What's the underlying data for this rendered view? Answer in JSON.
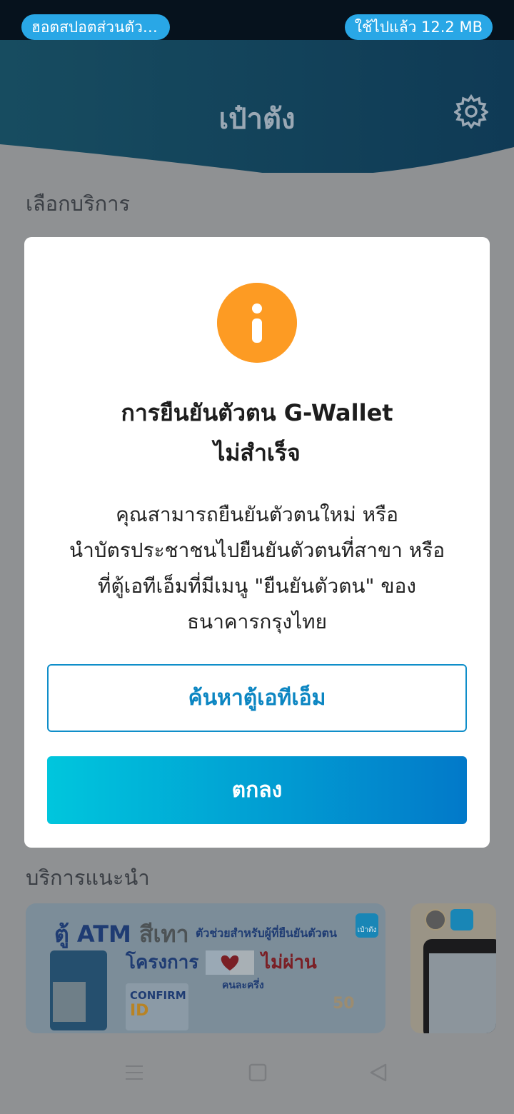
{
  "status_bar": {
    "hotspot_label": "ฮอตสปอตส่วนตัว ...",
    "data_usage_label": "ใช้ไปแล้ว 12.2 MB"
  },
  "header": {
    "title": "เป๋าตัง",
    "settings_icon": "gear-icon"
  },
  "main": {
    "select_service_label": "เลือกบริการ",
    "recommended_label": "บริการแนะนำ",
    "banners": [
      {
        "title_prefix": "ตู้ ATM",
        "title_color_word": "สีเทา",
        "subtitle": "ตัวช่วยสำหรับผู้ที่ยืนยันตัวตน",
        "project_label": "โครงการ",
        "fail_label": "ไม่ผ่าน",
        "half_half_label": "คนละครึ่ง",
        "confirm_label": "CONFIRM",
        "id_label": "ID",
        "badge": "เป๋าตัง",
        "amount_1": "50"
      }
    ]
  },
  "dialog": {
    "icon": "info-icon",
    "title_line1": "การยืนยันตัวตน G-Wallet",
    "title_line2": "ไม่สำเร็จ",
    "message_line1": "คุณสามารถยืนยันตัวตนใหม่ หรือ",
    "message_line2": "นำบัตรประชาชนไปยืนยันตัวตนที่สาขา หรือ",
    "message_line3": "ที่ตู้เอทีเอ็มที่มีเมนู \"ยืนยันตัวตน\" ของ",
    "message_line4": "ธนาคารกรุงไทย",
    "find_atm_label": "ค้นหาตู้เอทีเอ็ม",
    "ok_label": "ตกลง",
    "colors": {
      "icon": "#fd9b23",
      "accent": "#0c86c2",
      "gradient_start": "#00c6dd",
      "gradient_end": "#0279c9"
    }
  },
  "navigation": {
    "menu_icon": "menu-icon",
    "home_icon": "home-square-icon",
    "back_icon": "back-triangle-icon"
  }
}
